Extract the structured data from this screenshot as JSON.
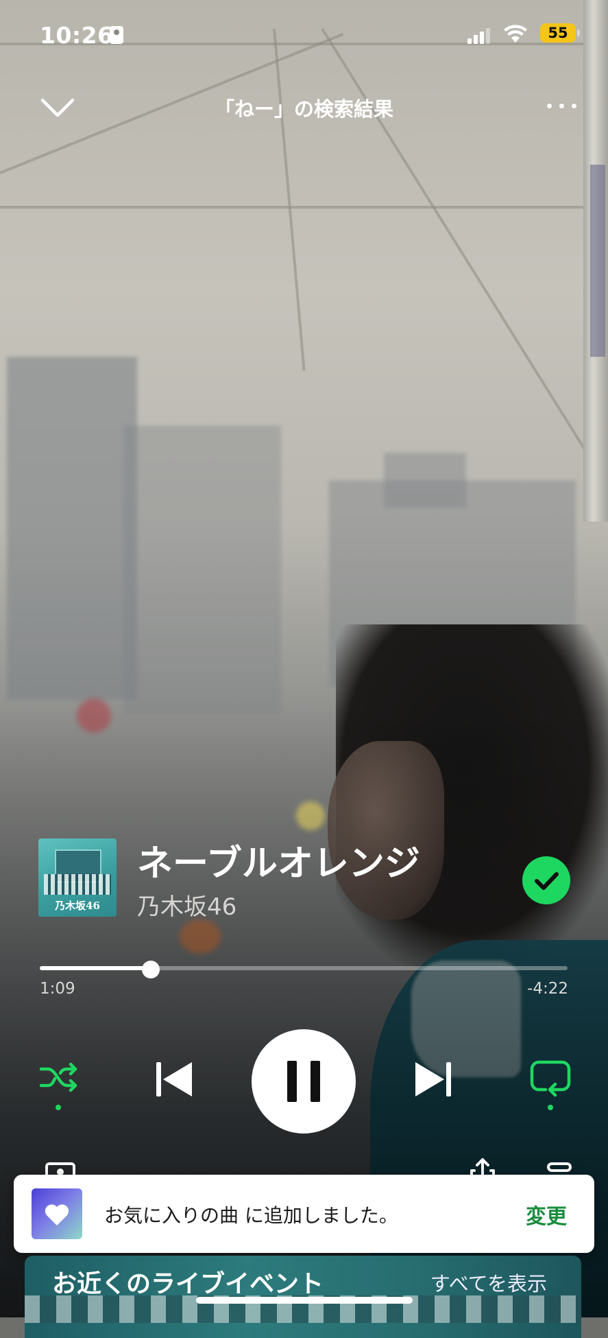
{
  "status_bar": {
    "time": "10:26",
    "battery": "55",
    "battery_color": "#f5c518"
  },
  "header": {
    "title": "「ねー」の検索結果",
    "collapse_icon": "chevron-down-icon",
    "more_icon": "more-horizontal-icon"
  },
  "track": {
    "title": "ネーブルオレンジ",
    "artist": "乃木坂46",
    "album_art_text": "乃木坂46",
    "liked": true,
    "liked_icon": "check-circle-icon"
  },
  "progress": {
    "elapsed": "1:09",
    "remaining": "-4:22",
    "fraction": 0.21
  },
  "controls": {
    "shuffle_icon": "shuffle-icon",
    "shuffle_active": true,
    "previous_icon": "skip-previous-icon",
    "play_pause_icon": "pause-icon",
    "next_icon": "skip-next-icon",
    "repeat_icon": "repeat-icon",
    "repeat_active": true
  },
  "lower_row": {
    "connect_icon": "devices-icon",
    "share_icon": "share-icon",
    "queue_icon": "queue-icon"
  },
  "toast": {
    "icon": "heart-icon",
    "message": "お気に入りの曲 に追加しました。",
    "action": "変更"
  },
  "events": {
    "title": "お近くのライブイベント",
    "see_all": "すべてを表示"
  },
  "colors": {
    "accent_green": "#1ed760",
    "toast_action_green": "#1a8c3e"
  }
}
